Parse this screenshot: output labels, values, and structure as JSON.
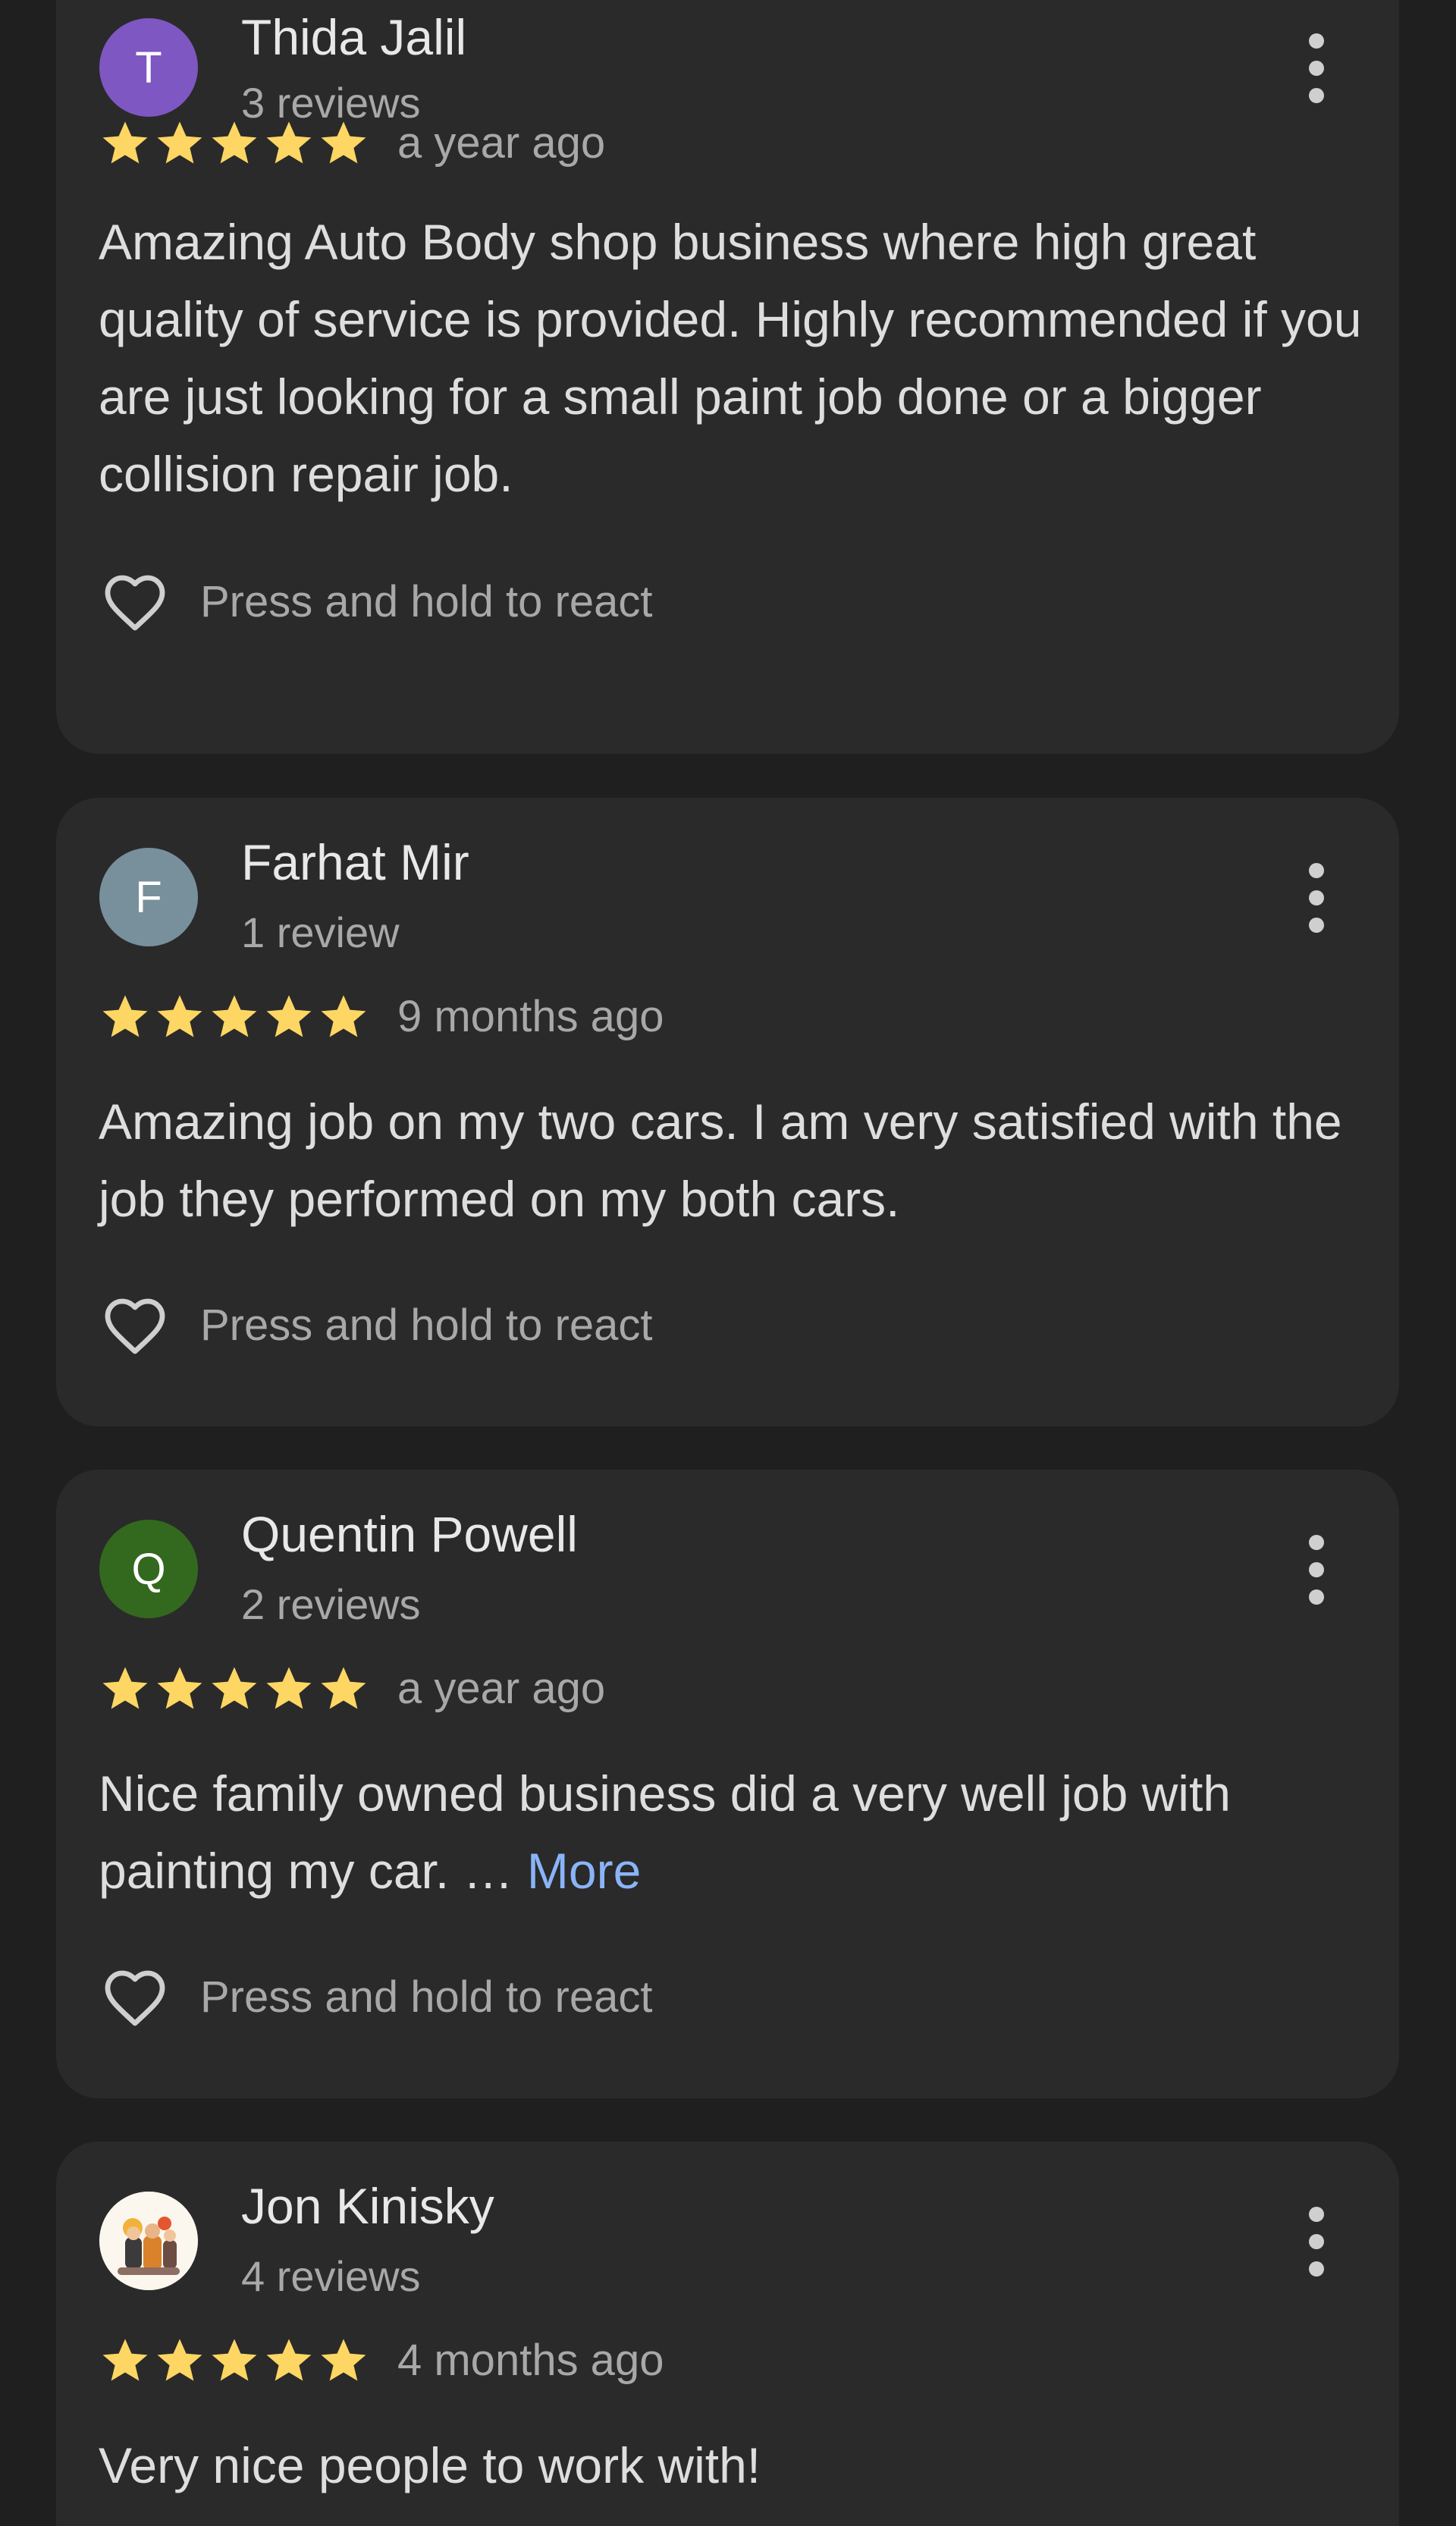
{
  "colors": {
    "page_background": "#1f1f1f",
    "card_background": "#2a2a2a",
    "star_color": "#fdd663",
    "link_color": "#8ab4f8"
  },
  "icons": {
    "star": "star-icon",
    "menu": "more-vert-icon",
    "react": "heart-outline-icon"
  },
  "reviews": [
    {
      "avatar_letter": "T",
      "avatar_color": "#7e57c2",
      "name": "Thida Jalil",
      "review_count": "3 reviews",
      "rating": 5,
      "date": "a year ago",
      "text": "Amazing Auto Body shop business where high great quality of service is provided. Highly recommended if you are just looking for a small paint job done or a bigger collision repair job.",
      "react_label": "Press and hold to react"
    },
    {
      "avatar_letter": "F",
      "avatar_color": "#78909c",
      "name": "Farhat Mir",
      "review_count": "1 review",
      "rating": 5,
      "date": "9 months ago",
      "text": "Amazing job on my two cars. I am very satisfied with the job they performed on my both cars.",
      "react_label": "Press and hold to react"
    },
    {
      "avatar_letter": "Q",
      "avatar_color": "#33691e",
      "name": "Quentin Powell",
      "review_count": "2 reviews",
      "rating": 5,
      "date": "a year ago",
      "text": "Nice family owned business did a very well job with painting my car. …",
      "more_label": "More",
      "react_label": "Press and hold to react"
    },
    {
      "avatar_letter": "",
      "avatar_color": "#ffffff",
      "name": "Jon Kinisky",
      "review_count": "4 reviews",
      "rating": 5,
      "date": "4 months ago",
      "text": "Very nice people to work with!"
    }
  ]
}
